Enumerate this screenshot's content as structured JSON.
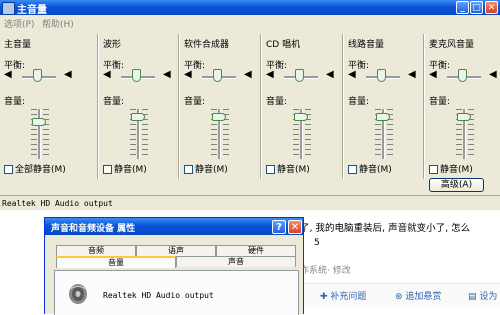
{
  "main_window": {
    "title": "主音量",
    "menu": [
      "选项(P)",
      "帮助(H)"
    ],
    "balance_label": "平衡:",
    "volume_label": "音量:",
    "columns": [
      {
        "name": "主音量",
        "mute_label": "全部静音(M)",
        "volume_level": 0.75
      },
      {
        "name": "波形",
        "mute_label": "静音(M)",
        "volume_level": 0.85
      },
      {
        "name": "软件合成器",
        "mute_label": "静音(M)",
        "volume_level": 0.85
      },
      {
        "name": "CD 唱机",
        "mute_label": "静音(M)",
        "volume_level": 0.85
      },
      {
        "name": "线路音量",
        "mute_label": "静音(M)",
        "volume_level": 0.85
      },
      {
        "name": "麦克风音量",
        "mute_label": "静音(M)",
        "volume_level": 0.85,
        "advanced_label": "高级(A)"
      }
    ],
    "status": "Realtek HD Audio output"
  },
  "background_page": {
    "question": "了, 我的电脑重装后, 声音就变小了, 怎么",
    "number": "5",
    "meta": "作系统· 修改",
    "actions": [
      "补充问题",
      "追加悬赏",
      "设为"
    ]
  },
  "dialog": {
    "title": "声音和音频设备 属性",
    "tabs_row1": [
      "音频",
      "语声",
      "硬件"
    ],
    "tabs_row2": [
      "音量",
      "声音"
    ],
    "device": "Realtek HD Audio output",
    "help_glyph": "?",
    "close_glyph": "✕"
  },
  "colors": {
    "titlebar": "#0a54d8",
    "window_bg": "#ece9d8",
    "link": "#2d64b3"
  }
}
